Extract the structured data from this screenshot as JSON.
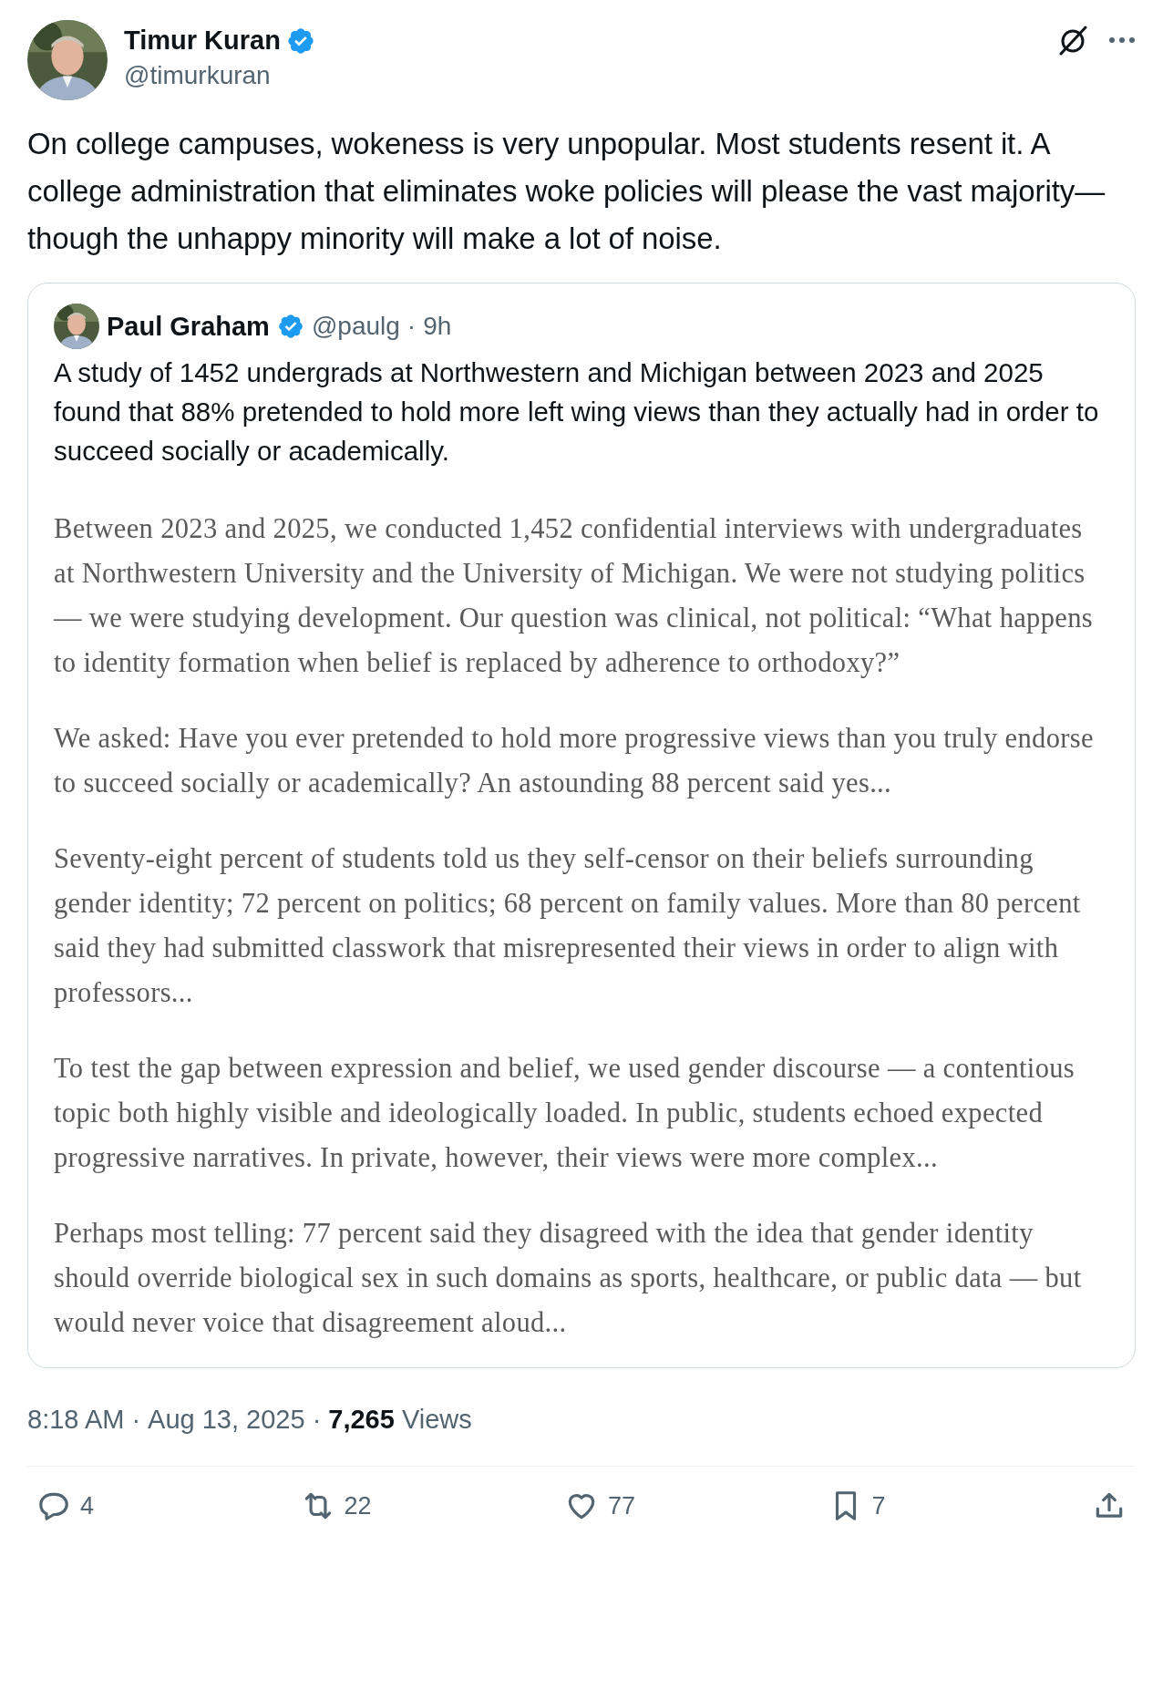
{
  "author": {
    "name": "Timur Kuran",
    "handle": "@timurkuran",
    "verified": true
  },
  "text": "On college campuses, wokeness is very unpopular. Most students resent it. A college administration that eliminates woke policies will please the vast majority—though the unhappy minority will make a lot of noise.",
  "quote": {
    "name": "Paul Graham",
    "verified": true,
    "handle": "@paulg",
    "dot": "·",
    "time": "9h",
    "text": "A study of 1452 undergrads at Northwestern and Michigan between 2023 and 2025 found that 88% pretended to hold more left wing views than they actually had in order to succeed socially or academically.",
    "document": [
      "Between 2023 and 2025, we conducted 1,452 confidential interviews with undergraduates at Northwestern University and the University of Michigan. We were not studying politics — we were studying development. Our question was clinical, not political: “What happens to identity formation when belief is replaced by adherence to orthodoxy?”",
      "We asked: Have you ever pretended to hold more progressive views than you truly endorse to succeed socially or academically? An astounding 88 percent said yes...",
      "Seventy-eight percent of students told us they self-censor on their beliefs surrounding gender identity; 72 percent on politics; 68 percent on family values. More than 80 percent said they had submitted classwork that misrepresented their views in order to align with professors...",
      "To test the gap between expression and belief, we used gender discourse — a contentious topic both highly visible and ideologically loaded. In public, students echoed expected progressive narratives. In private, however, their views were more complex...",
      "Perhaps most telling: 77 percent said they disagreed with the idea that gender identity should override biological sex in such domains as sports, healthcare, or public data — but would never voice that disagreement aloud..."
    ]
  },
  "meta": {
    "time": "8:18 AM",
    "dot1": "·",
    "date": "Aug 13, 2025",
    "dot2": "·",
    "views_count": "7,265",
    "views_label": "Views"
  },
  "actions": [
    {
      "kind": "reply",
      "count": "4"
    },
    {
      "kind": "repost",
      "count": "22"
    },
    {
      "kind": "like",
      "count": "77"
    },
    {
      "kind": "bookmark",
      "count": "7"
    },
    {
      "kind": "share"
    }
  ]
}
